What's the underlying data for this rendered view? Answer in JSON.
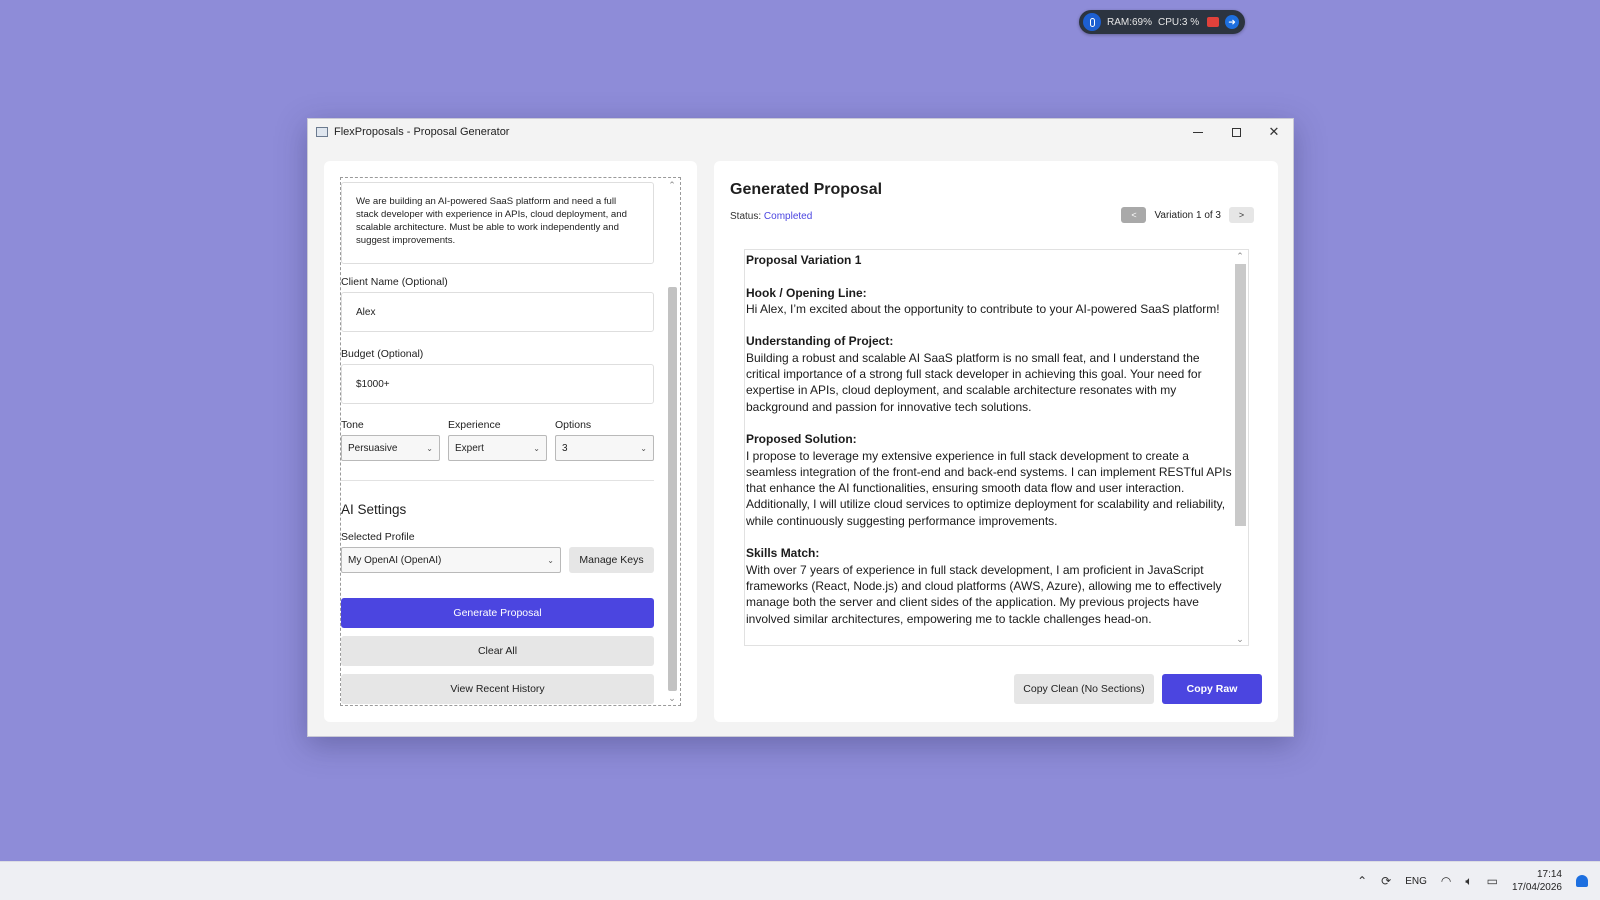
{
  "sysmon": {
    "ram": "RAM:69%",
    "cpu": "CPU:3 %"
  },
  "window": {
    "title": "FlexProposals - Proposal Generator",
    "minimize": "–",
    "maximize": "□",
    "close": "✕"
  },
  "form": {
    "description": "We are building an AI-powered SaaS platform and need a full stack developer with experience in APIs, cloud deployment, and scalable architecture. Must be able to work independently and suggest improvements.",
    "client_name_label": "Client Name (Optional)",
    "client_name_value": "Alex",
    "budget_label": "Budget (Optional)",
    "budget_value": "$1000+",
    "tone_label": "Tone",
    "tone_value": "Persuasive",
    "experience_label": "Experience",
    "experience_value": "Expert",
    "options_label": "Options",
    "options_value": "3"
  },
  "ai_settings": {
    "title": "AI Settings",
    "profile_label": "Selected Profile",
    "profile_value": "My OpenAI (OpenAI)",
    "manage_keys": "Manage Keys"
  },
  "actions": {
    "generate": "Generate Proposal",
    "clear": "Clear All",
    "history": "View Recent History"
  },
  "output": {
    "title": "Generated Proposal",
    "status_label": "Status:",
    "status_value": "Completed",
    "prev": "<",
    "variation": "Variation 1 of 3",
    "next": ">",
    "variation_heading": "Proposal Variation 1",
    "hook_heading": "Hook / Opening Line:",
    "hook_text": "Hi Alex, I’m excited about the opportunity to contribute to your AI-powered SaaS platform!",
    "understanding_heading": "Understanding of Project:",
    "understanding_text": "Building a robust and scalable AI SaaS platform is no small feat, and I understand the critical importance of a strong full stack developer in achieving this goal. Your need for expertise in APIs, cloud deployment, and scalable architecture resonates with my background and passion for innovative tech solutions.",
    "solution_heading": "Proposed Solution:",
    "solution_text": "I propose to leverage my extensive experience in full stack development to create a seamless integration of the front-end and back-end systems. I can implement RESTful APIs that enhance the AI functionalities, ensuring smooth data flow and user interaction. Additionally, I will utilize cloud services to optimize deployment for scalability and reliability, while continuously suggesting performance improvements.",
    "skills_heading": "Skills Match:",
    "skills_text": "With over 7 years of experience in full stack development, I am proficient in JavaScript frameworks (React, Node.js) and cloud platforms (AWS, Azure), allowing me to effectively manage both the server and client sides of the application. My previous projects have involved similar architectures, empowering me to tackle challenges head-on.",
    "copy_clean": "Copy Clean (No Sections)",
    "copy_raw": "Copy Raw"
  },
  "taskbar": {
    "language": "ENG",
    "time": "17:14",
    "date": "17/04/2026"
  },
  "colors": {
    "accent": "#4b45e0",
    "desktop": "#8e8cd8"
  }
}
